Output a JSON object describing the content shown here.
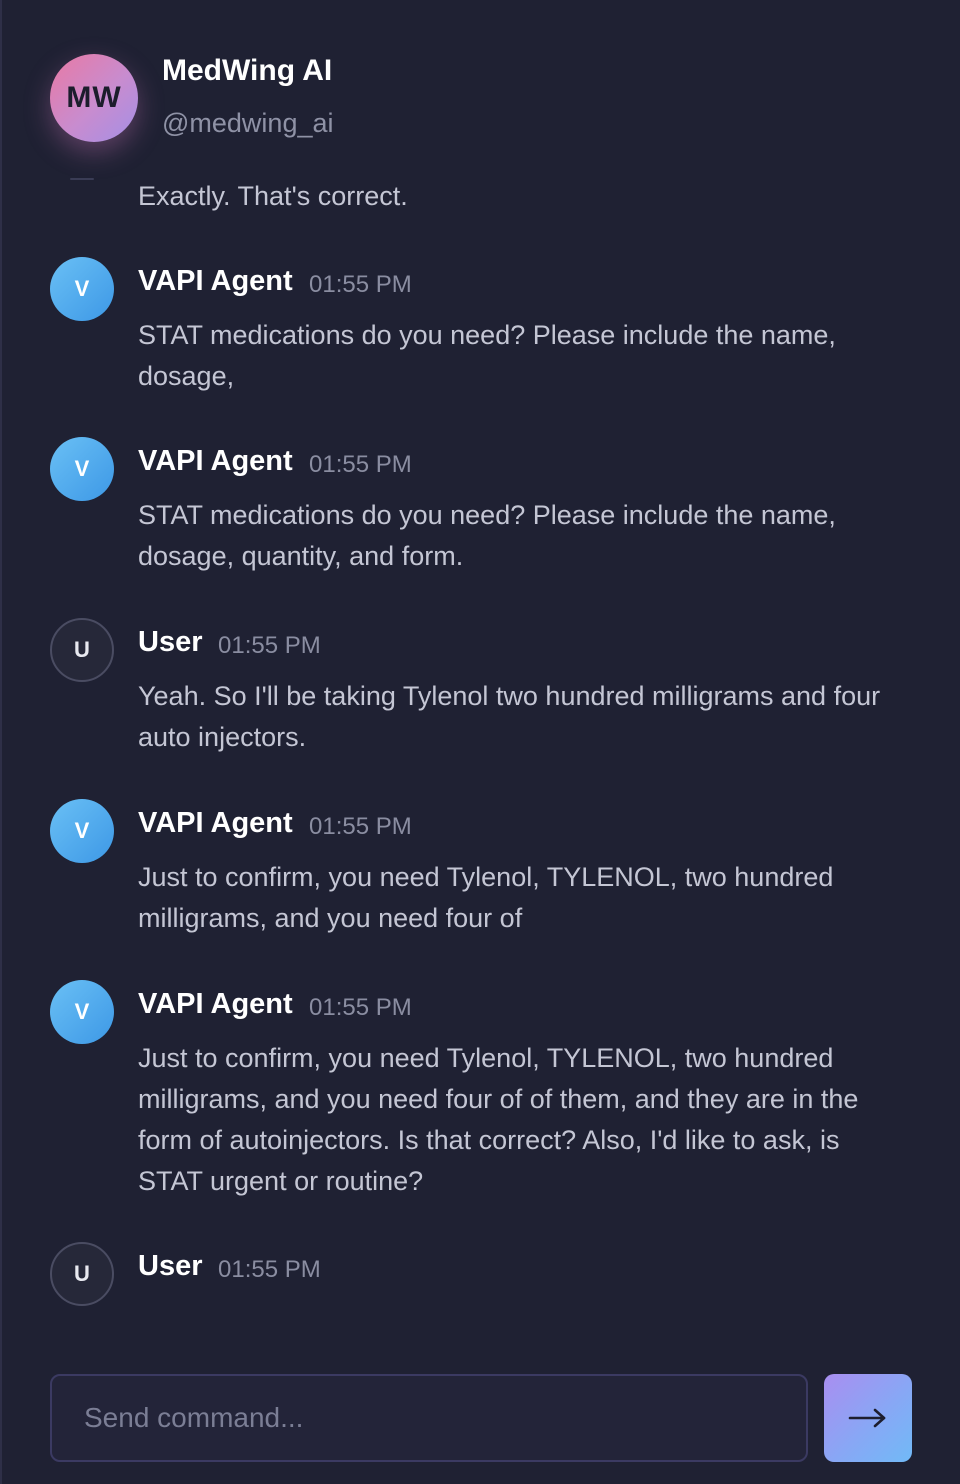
{
  "header": {
    "avatar_initials": "MW",
    "name": "MedWing AI",
    "handle": "@medwing_ai"
  },
  "partial_message": {
    "text": "Exactly. That's correct."
  },
  "messages": [
    {
      "avatar": "V",
      "role": "agent",
      "sender": "VAPI Agent",
      "time": "01:55 PM",
      "text": "STAT medications do you need? Please include the name, dosage,"
    },
    {
      "avatar": "V",
      "role": "agent",
      "sender": "VAPI Agent",
      "time": "01:55 PM",
      "text": "STAT medications do you need? Please include the name, dosage, quantity, and form."
    },
    {
      "avatar": "U",
      "role": "user",
      "sender": "User",
      "time": "01:55 PM",
      "text": "Yeah. So I'll be taking Tylenol two hundred milligrams and four auto injectors."
    },
    {
      "avatar": "V",
      "role": "agent",
      "sender": "VAPI Agent",
      "time": "01:55 PM",
      "text": "Just to confirm, you need Tylenol, TYLENOL, two hundred milligrams, and you need four of"
    },
    {
      "avatar": "V",
      "role": "agent",
      "sender": "VAPI Agent",
      "time": "01:55 PM",
      "text": "Just to confirm, you need Tylenol, TYLENOL, two hundred milligrams, and you need four of of them, and they are in the form of autoinjectors. Is that correct? Also, I'd like to ask, is STAT urgent or routine?"
    },
    {
      "avatar": "U",
      "role": "user",
      "sender": "User",
      "time": "01:55 PM",
      "text": ""
    }
  ],
  "composer": {
    "placeholder": "Send command...",
    "value": "",
    "send_icon": "arrow-right-icon"
  },
  "colors": {
    "background": "#1f2133",
    "agent_avatar": "#4ba8ec",
    "accent_gradient_start": "#a98ef0",
    "accent_gradient_end": "#71baf7"
  }
}
